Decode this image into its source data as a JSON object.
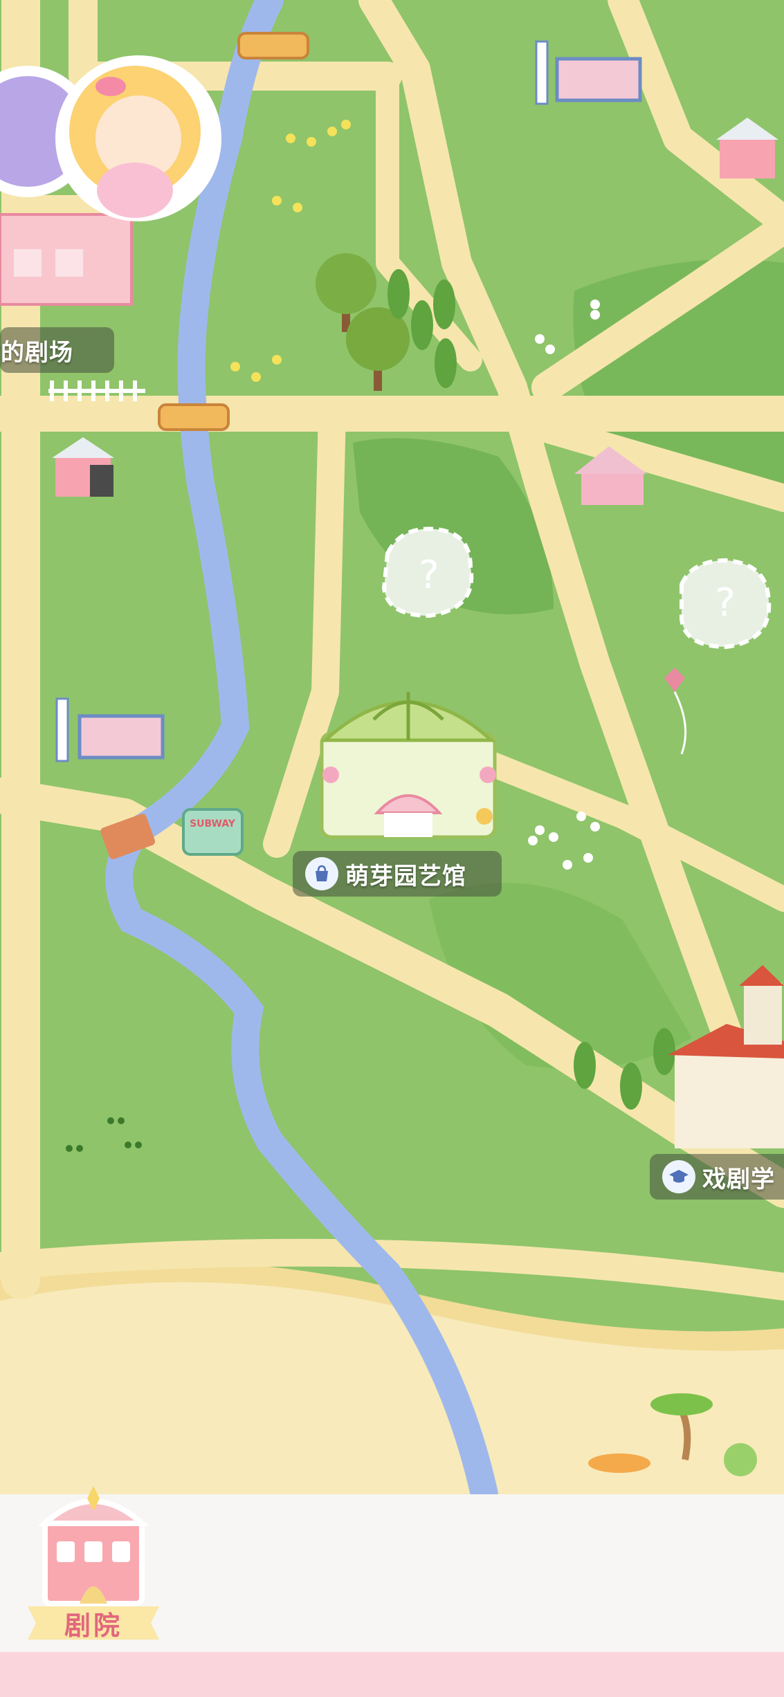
{
  "map": {
    "labels": {
      "theater": "你的剧场",
      "greenhouse": "萌芽园艺馆",
      "drama_school": "戏剧学"
    },
    "unknown_marker": "?",
    "signs": {
      "subway": "SUBWAY"
    }
  },
  "bottom_nav": {
    "theater_label": "剧院"
  },
  "colors": {
    "grass": "#8fc46a",
    "grass_dark": "#6fae4f",
    "path": "#f6e6ad",
    "river": "#9fb8ec",
    "sand": "#f7e7b0",
    "pink_accent": "#fbd5dc"
  },
  "icons": [
    "bag-icon",
    "graduation-cap-icon",
    "question-mark-icon"
  ]
}
